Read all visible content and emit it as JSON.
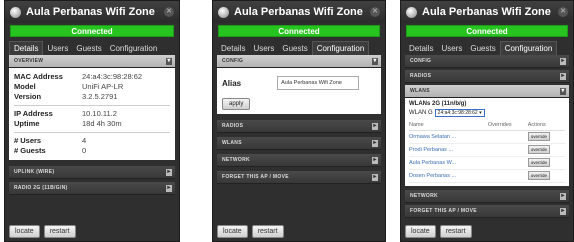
{
  "title": "Aula Perbanas Wifi Zone",
  "status": "Connected",
  "tabs": [
    "Details",
    "Users",
    "Guests",
    "Configuration"
  ],
  "p1": {
    "overview": "OVERVIEW",
    "rows1": [
      {
        "k": "MAC Address",
        "v": "24:a4:3c:98:28:62"
      },
      {
        "k": "Model",
        "v": "UniFi AP-LR"
      },
      {
        "k": "Version",
        "v": "3.2.5.2791"
      }
    ],
    "rows2": [
      {
        "k": "IP Address",
        "v": "10.10.11.2"
      },
      {
        "k": "Uptime",
        "v": "18d 4h 30m"
      }
    ],
    "rows3": [
      {
        "k": "# Users",
        "v": "4"
      },
      {
        "k": "# Guests",
        "v": "0"
      }
    ],
    "sections": [
      "UPLINK (WIRE)",
      "RADIO 2G (11B/G/N)"
    ]
  },
  "p2": {
    "config": "CONFIG",
    "alias_label": "Alias",
    "alias_value": "Aula Perbanas Wifi Zone",
    "apply": "apply",
    "sections": [
      "RADIOS",
      "WLANS",
      "NETWORK",
      "FORGET THIS AP / MOVE"
    ]
  },
  "p3": {
    "sections_top": [
      "CONFIG",
      "RADIOS",
      "WLANS"
    ],
    "wlan_title": "WLANs 2G (11n/b/g)",
    "wlan_group_label": "WLAN G",
    "wlan_group_value": "24:a4:3c:98:28:62",
    "cols": [
      "Name",
      "Overrides",
      "Actions"
    ],
    "rows": [
      "Ormawa Selatan ...",
      "Prodi Perbanas ...",
      "Aula Perbanas W...",
      "Dosen Perbanas ..."
    ],
    "override": "override",
    "sections_bottom": [
      "NETWORK",
      "FORGET THIS AP / MOVE"
    ]
  },
  "buttons": {
    "locate": "locate",
    "restart": "restart"
  }
}
